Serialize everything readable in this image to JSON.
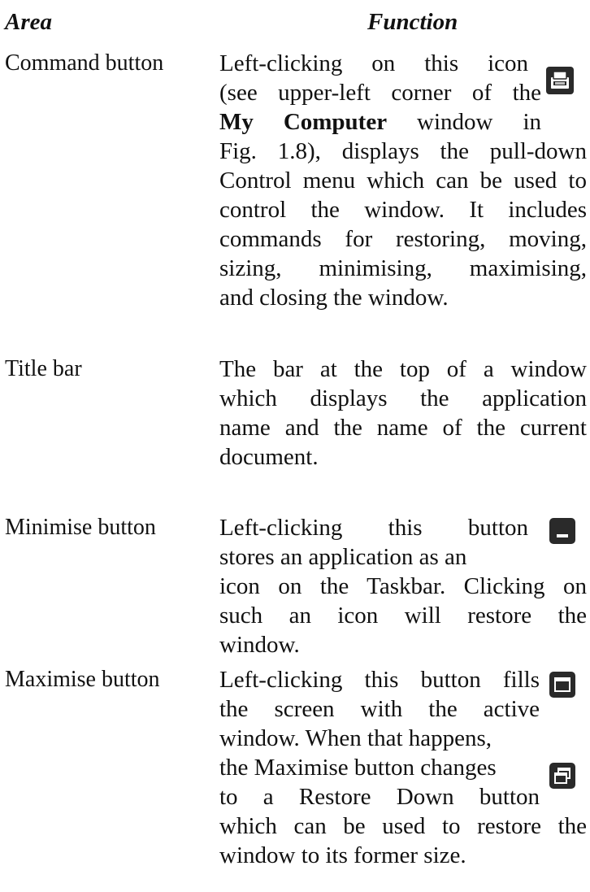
{
  "headers": {
    "area": "Area",
    "function": "Function"
  },
  "entries": [
    {
      "term": "Command button",
      "lines": [
        "Left-clicking on this icon",
        "(see upper-left corner of the",
        "window in",
        "Fig. 1.8), displays the pull-down",
        "Control menu which can be used to",
        "control the window. It includes",
        "commands for restoring, moving,",
        "sizing, minimising, maximising,",
        "and closing the window."
      ],
      "bold_phrase": "My Computer",
      "icon": "control-menu-icon"
    },
    {
      "term": "Title bar",
      "lines": [
        "The bar at the top of a window",
        "which displays the application",
        "name and the name of the current",
        "document."
      ]
    },
    {
      "term": "Minimise button",
      "lines": [
        "Left-clicking this button",
        "stores an application as an",
        "icon on the Taskbar. Clicking on",
        "such an icon will restore the",
        "window."
      ],
      "icon": "minimise-icon"
    },
    {
      "term": "Maximise button",
      "lines": [
        "Left-clicking this button fills",
        "the screen with the active",
        "window. When that happens,",
        "the Maximise button changes",
        "to a Restore Down button",
        "which can be used to restore the",
        "window to its former size."
      ],
      "icons": [
        "maximise-icon",
        "restore-down-icon"
      ]
    }
  ]
}
